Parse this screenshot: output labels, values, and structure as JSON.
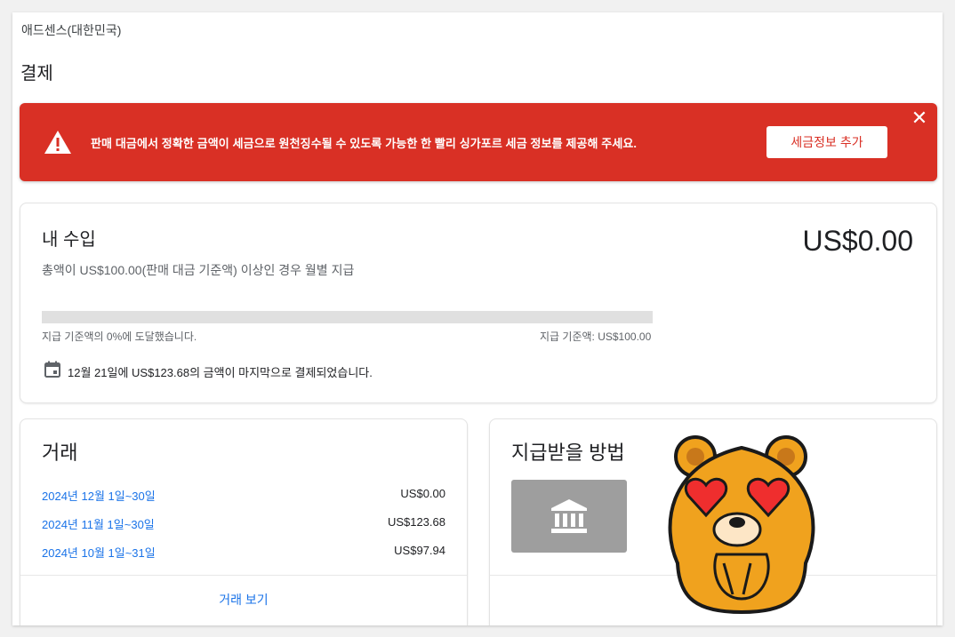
{
  "account": {
    "name": "애드센스(대한민국)"
  },
  "page": {
    "title": "결제"
  },
  "banner": {
    "message": "판매 대금에서 정확한 금액이 세금으로 원천징수될 수 있도록 가능한 한 빨리 싱가포르 세금 정보를 제공해 주세요.",
    "button_label": "세금정보 추가",
    "close_symbol": "✕",
    "color": "#d93025"
  },
  "earnings": {
    "title": "내 수입",
    "subtitle": "총액이 US$100.00(판매 대금 기준액) 이상인 경우 월별 지급",
    "amount": "US$0.00",
    "progress_percent": 0,
    "progress_left_label": "지급 기준액의 0%에 도달했습니다.",
    "progress_right_label": "지급 기준액: US$100.00",
    "last_payment_text": "12월 21일에 US$123.68의 금액이 마지막으로 결제되었습니다."
  },
  "transactions": {
    "title": "거래",
    "rows": [
      {
        "period": "2024년 12월 1일~30일",
        "amount": "US$0.00"
      },
      {
        "period": "2024년 11월 1일~30일",
        "amount": "US$123.68"
      },
      {
        "period": "2024년 10월 1일~31일",
        "amount": "US$97.94"
      }
    ],
    "view_link": "거래 보기"
  },
  "payment_method": {
    "title": "지급받을 방법"
  },
  "icons": {
    "warning": "warning-icon",
    "calendar": "calendar-icon",
    "bank": "bank-icon",
    "close": "close-icon"
  },
  "colors": {
    "link": "#1a73e8",
    "banner": "#d93025",
    "bank_tile": "#9e9e9e"
  }
}
